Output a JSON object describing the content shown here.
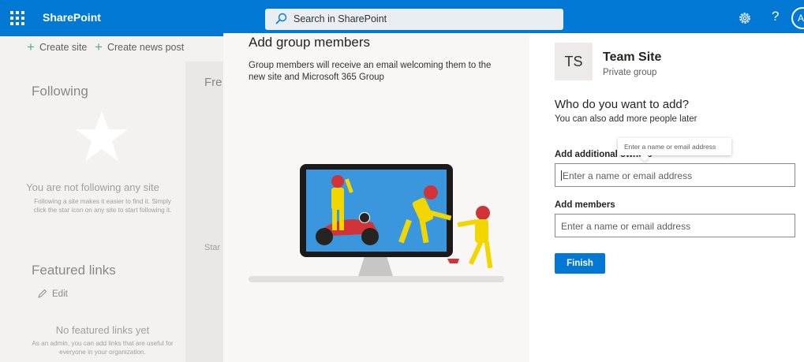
{
  "header": {
    "app_title": "SharePoint",
    "search_placeholder": "Search in SharePoint",
    "help_icon": "?",
    "avatar_initial": "A",
    "brand_color": "#0078d4"
  },
  "commands": {
    "create_site": "Create site",
    "create_news_post": "Create news post"
  },
  "following": {
    "heading": "Following",
    "empty_title": "You are not following any site",
    "empty_help": "Following a site makes it easier to find it. Simply click the star icon on any site to start following it."
  },
  "featured": {
    "heading": "Featured links",
    "edit_label": "Edit",
    "empty_title": "No featured links yet",
    "empty_help": "As an admin, you can add links that are useful for everyone in your organization."
  },
  "background": {
    "partial_heading": "Fre",
    "partial_text": "Star"
  },
  "panel": {
    "title": "Add group members",
    "description": "Group members will receive an email welcoming them to the new site and Microsoft 365 Group",
    "site_initials": "TS",
    "site_name": "Team Site",
    "site_type": "Private group",
    "who_heading": "Who do you want to add?",
    "who_subtext": "You can also add more people later",
    "tooltip_text": "Enter a name or email address",
    "owners_label": "Add additional owners",
    "owners_placeholder": "Enter a name or email address",
    "members_label": "Add members",
    "members_placeholder": "Enter a name or email address",
    "finish_label": "Finish"
  },
  "icons": [
    "waffle-icon",
    "search-icon",
    "gear-icon",
    "help-icon",
    "plus-icon",
    "star-icon",
    "pencil-icon",
    "race-illustration"
  ]
}
